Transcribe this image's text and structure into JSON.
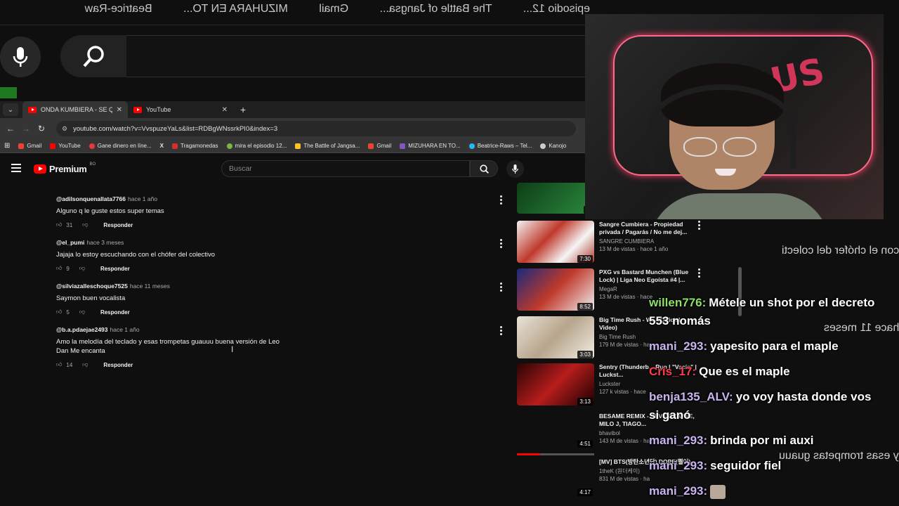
{
  "mirror": {
    "top_text": [
      "Beatrice-Raw",
      "MIZUHARA EN TO...",
      "Gmail",
      "The Battle of Jangsa...",
      "episodio 12..."
    ],
    "side_texts": [
      "con el chófer del colecti",
      "hace 11 meses",
      "y esas trompetas guauu"
    ]
  },
  "tabs": [
    {
      "label": "ONDA KUMBIERA - SE QUE TE...",
      "active": true
    },
    {
      "label": "YouTube",
      "active": false
    }
  ],
  "url": "youtube.com/watch?v=VvspuzeYaLs&list=RDBgWNssrkPI0&index=3",
  "bookmarks": [
    {
      "label": "Gmail",
      "color": "#ea4335"
    },
    {
      "label": "YouTube",
      "color": "#ff0000"
    },
    {
      "label": "Gane dinero en líne...",
      "color": "#e53935"
    },
    {
      "label": "",
      "color": "#ffffff"
    },
    {
      "label": "Tragamonedas",
      "color": "#d32f2f"
    },
    {
      "label": "mira el episodio 12...",
      "color": "#7cb342"
    },
    {
      "label": "The Battle of Jangsa...",
      "color": "#fbc02d"
    },
    {
      "label": "Gmail",
      "color": "#ea4335"
    },
    {
      "label": "MIZUHARA EN TO...",
      "color": "#7e57c2"
    },
    {
      "label": "Beatrice-Raws – Tel...",
      "color": "#29b6f6"
    },
    {
      "label": "Kanojo",
      "color": "#cccccc"
    }
  ],
  "yt": {
    "brand": "Premium",
    "region": "BO",
    "search_placeholder": "Buscar"
  },
  "comments": [
    {
      "user": "@adilsonquenallata7766",
      "time": "hace 1 año",
      "body": "Alguno q le guste estos super temas",
      "likes": "31",
      "reply": "Responder"
    },
    {
      "user": "@el_pumi",
      "time": "hace 3 meses",
      "body": "Jajaja lo estoy escuchando con el chófer del colectivo",
      "likes": "9",
      "reply": "Responder"
    },
    {
      "user": "@silviazalleschoque7525",
      "time": "hace 11 meses",
      "body": "Saymon buen vocalista",
      "likes": "5",
      "reply": "Responder"
    },
    {
      "user": "@b.a.pdaejae2493",
      "time": "hace 1 año",
      "body": "Amo la melodía del teclado y esas trompetas guauuu buena versión de Leo Dan Me encanta",
      "likes": "14",
      "reply": "Responder"
    }
  ],
  "recommended": [
    {
      "title": "",
      "channel": "",
      "views": "",
      "duration": "3:",
      "thumb": "#1d6b2a"
    },
    {
      "title": "Sangre Cumbiera - Propiedad privada / Pagarás / No me dej...",
      "channel": "SANGRE CUMBIERA",
      "views": "13 M de vistas · hace 1 año",
      "duration": "7:30",
      "thumb": "#c05a4a"
    },
    {
      "title": "PXG vs Bastard Munchen (Blue Lock) | Liga Neo Egoísta #4 |...",
      "channel": "MegaR",
      "views": "13 M de vistas · hace",
      "duration": "8:52",
      "thumb": "#2c3a8a"
    },
    {
      "title": "Big Time Rush - W... (Official Video)",
      "channel": "Big Time Rush",
      "views": "179 M de vistas · ha",
      "duration": "3:03",
      "thumb": "#b8b0a4"
    },
    {
      "title": "Sentry (Thunderb... Run | \"Vacío\" | Luckst...",
      "channel": "Luckster",
      "views": "127 k vistas · hace",
      "duration": "3:13",
      "thumb": "#8a1a1a"
    },
    {
      "title": "BESAME REMIX - SEVEN KAYNE, MILO J, TIAGO...",
      "channel": "bhavibol",
      "views": "143 M de vistas · ha",
      "duration": "4:51",
      "thumb": "#0f0f0f"
    },
    {
      "title": "[MV] BTS(방탄소년단) DOPE(쩔어)",
      "channel": "1theK (원더케이)",
      "views": "831 M de vistas · ha",
      "duration": "4:17",
      "thumb": "#0f0f0f"
    }
  ],
  "cam": {
    "neon": "FABUS"
  },
  "chat": [
    {
      "user": "willen776:",
      "msg": "Métele un shot por el decreto 553 nomás",
      "color": "#8de06a"
    },
    {
      "user": "mani_293:",
      "msg": "yapesito para el maple",
      "color": "#c9b3f0"
    },
    {
      "user": "Cris_17:",
      "msg": "Que es el maple",
      "color": "#ff3b4e"
    },
    {
      "user": "benja135_ALV:",
      "msg": "yo voy hasta donde vos si ganó",
      "color": "#c9b3f0"
    },
    {
      "user": "mani_293:",
      "msg": "brinda por mi auxi",
      "color": "#c9b3f0"
    },
    {
      "user": "mani_293:",
      "msg": "seguidor fiel",
      "color": "#c9b3f0"
    },
    {
      "user": "mani_293:",
      "msg": "",
      "color": "#c9b3f0"
    }
  ]
}
